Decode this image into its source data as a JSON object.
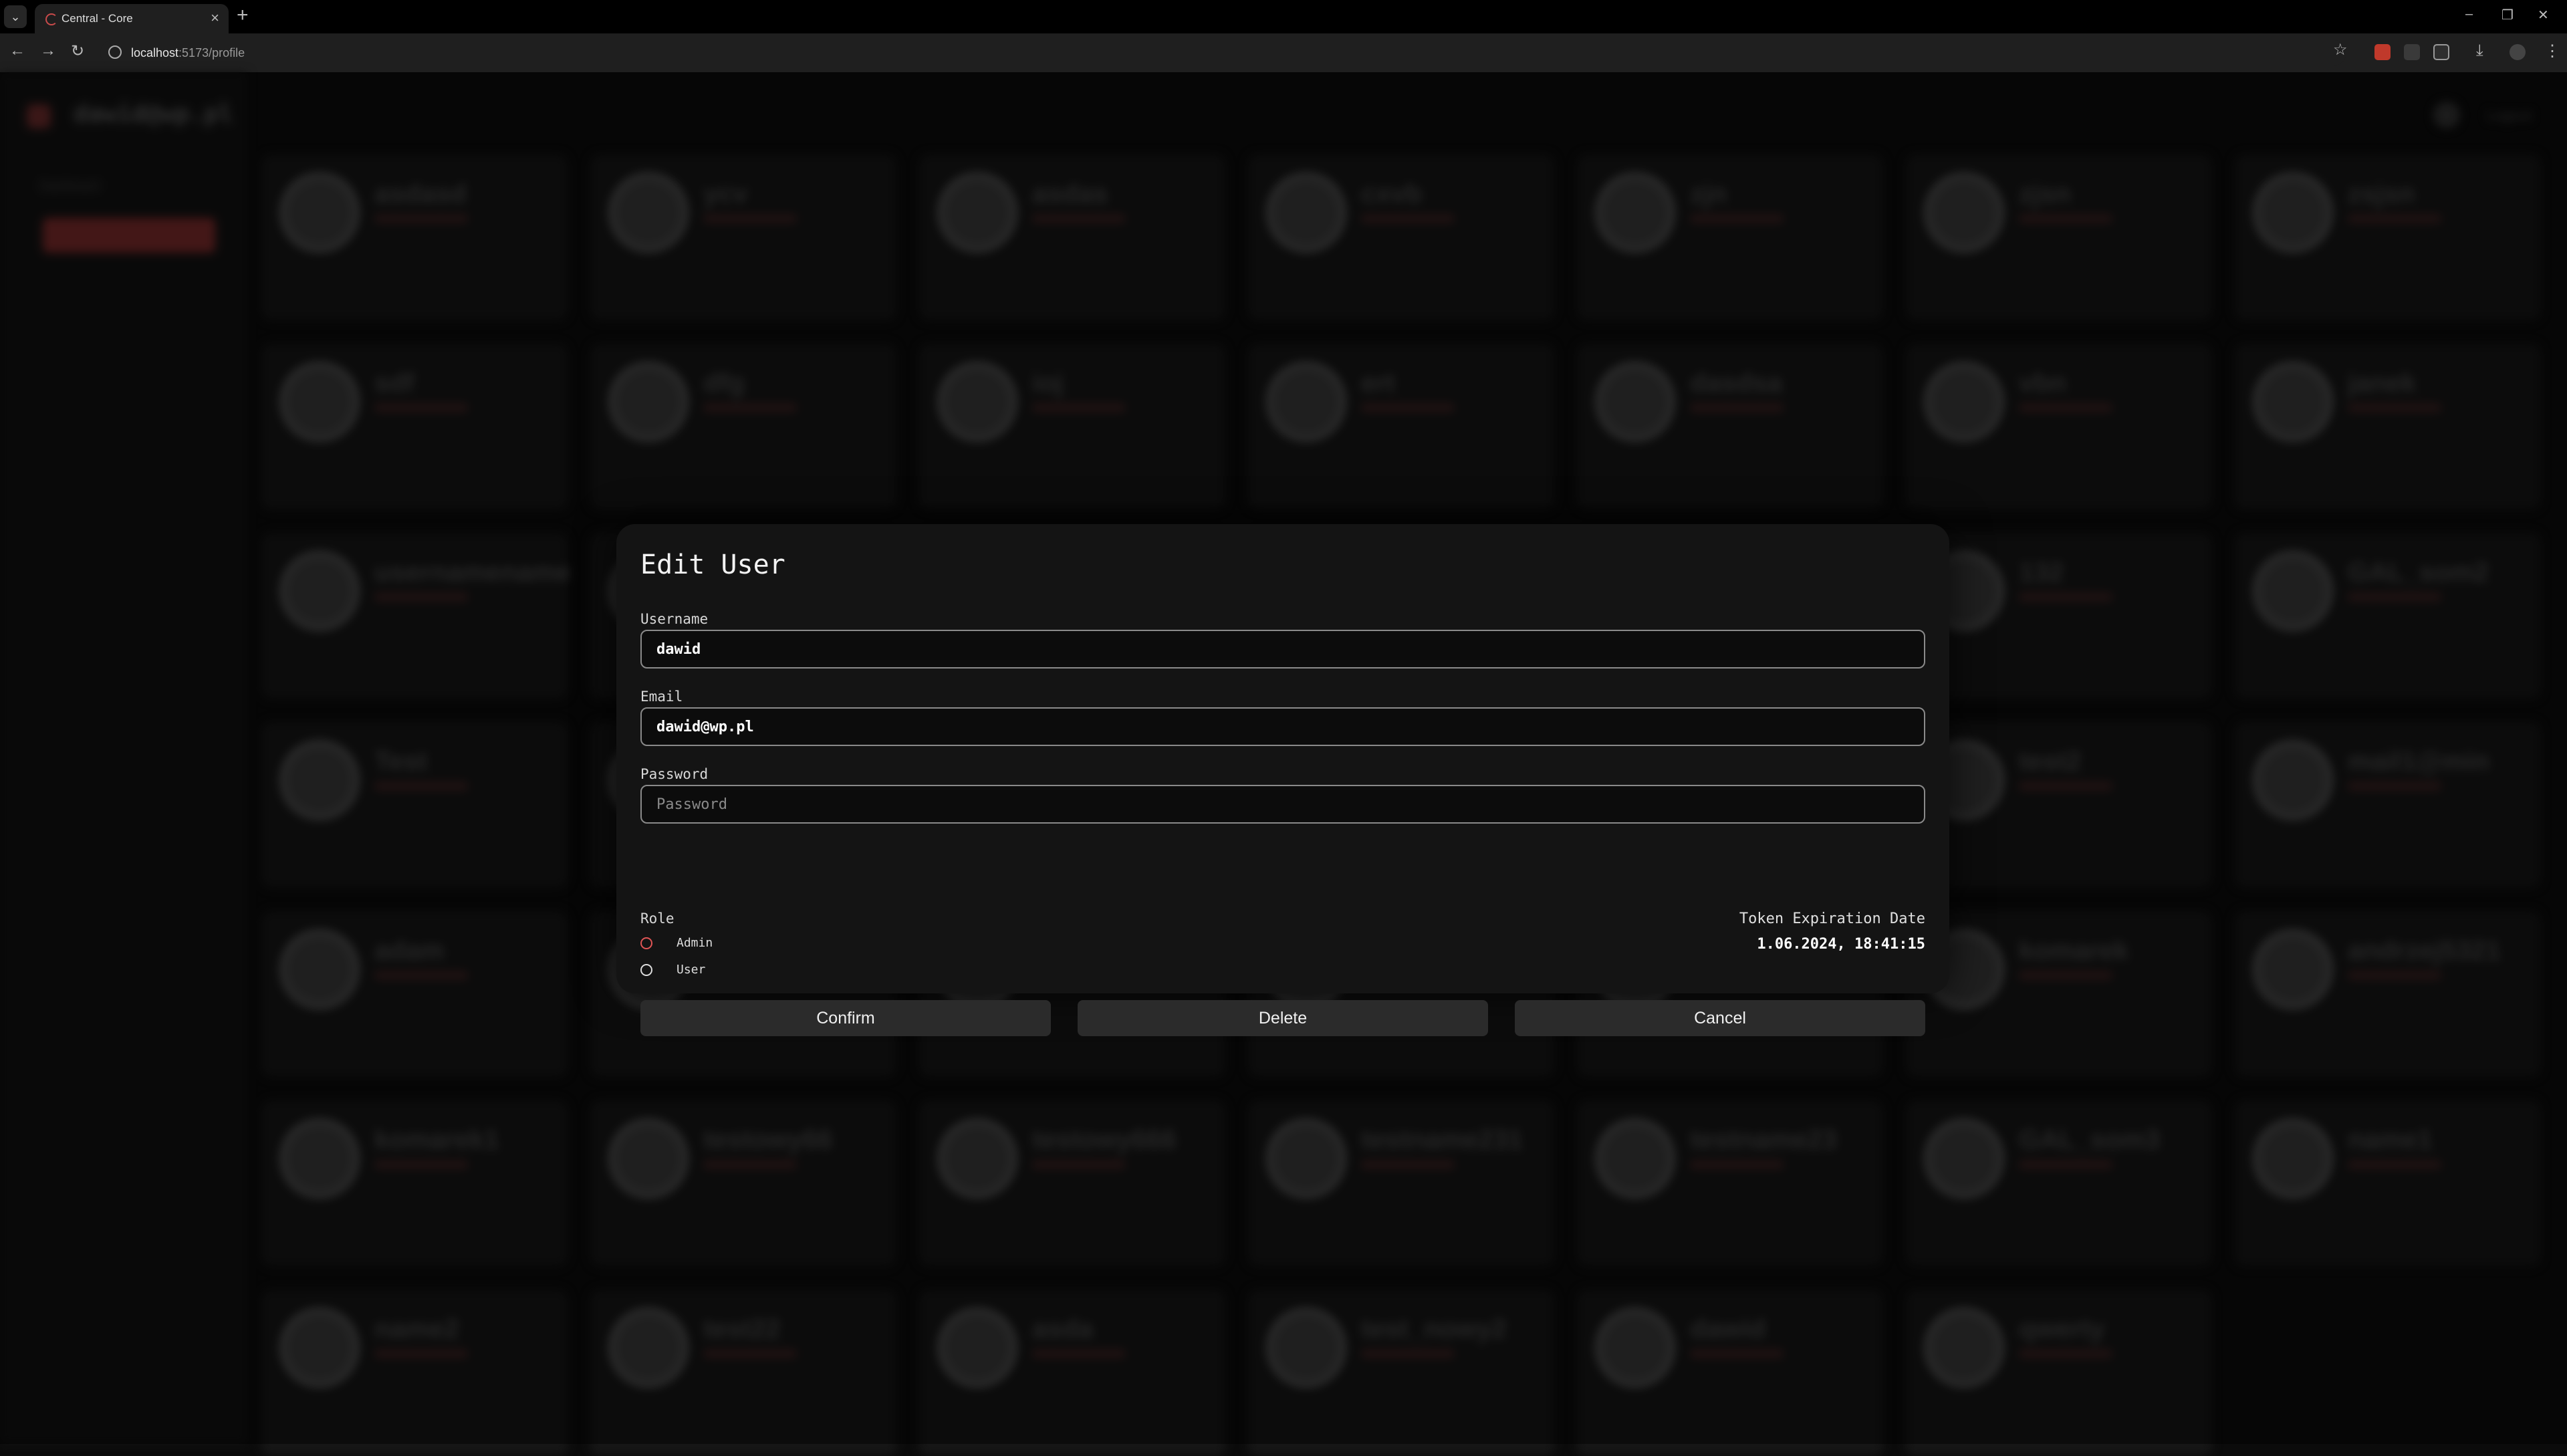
{
  "browser": {
    "tab_title": "Central - Core",
    "url_host": "localhost",
    "url_path": ":5173/profile",
    "new_tab": "+",
    "close_tab": "×"
  },
  "app": {
    "sidebar_user": "dawid@wp.pl",
    "sidebar_item": "Dashboard",
    "logout": "Logout",
    "users": [
      "asdasd",
      "ycv",
      "asdas",
      "cxvb",
      "zjn",
      "zjsn",
      "zsjsn",
      "sdf",
      "dfg",
      "ioj",
      "ert",
      "dasdsa",
      "vbn",
      "janek",
      "usernamename",
      "",
      "",
      "",
      "",
      "132",
      "GAL_som2",
      "Test",
      "",
      "",
      "",
      "",
      "test2",
      "mail1@min",
      "adam",
      "",
      "",
      "",
      "",
      "komarek",
      "andrzej5321",
      "komarek1",
      "testowy66",
      "testowy666",
      "testname231",
      "testname23",
      "GAL_som3",
      "name1",
      "name2",
      "test22",
      "asda",
      "test_nowy2",
      "dawid",
      "qwerty",
      ""
    ]
  },
  "modal": {
    "title": "Edit User",
    "username_label": "Username",
    "username_value": "dawid",
    "email_label": "Email",
    "email_value": "dawid@wp.pl",
    "password_label": "Password",
    "password_placeholder": "Password",
    "role_label": "Role",
    "roles": [
      "Admin",
      "User"
    ],
    "selected_role": "Admin",
    "token_label": "Token Expiration Date",
    "token_value": "1.06.2024, 18:41:15",
    "confirm_label": "Confirm",
    "delete_label": "Delete",
    "cancel_label": "Cancel"
  },
  "colors": {
    "accent": "#e05555",
    "modal_bg": "#141414",
    "button_bg": "#2b2b2b"
  }
}
